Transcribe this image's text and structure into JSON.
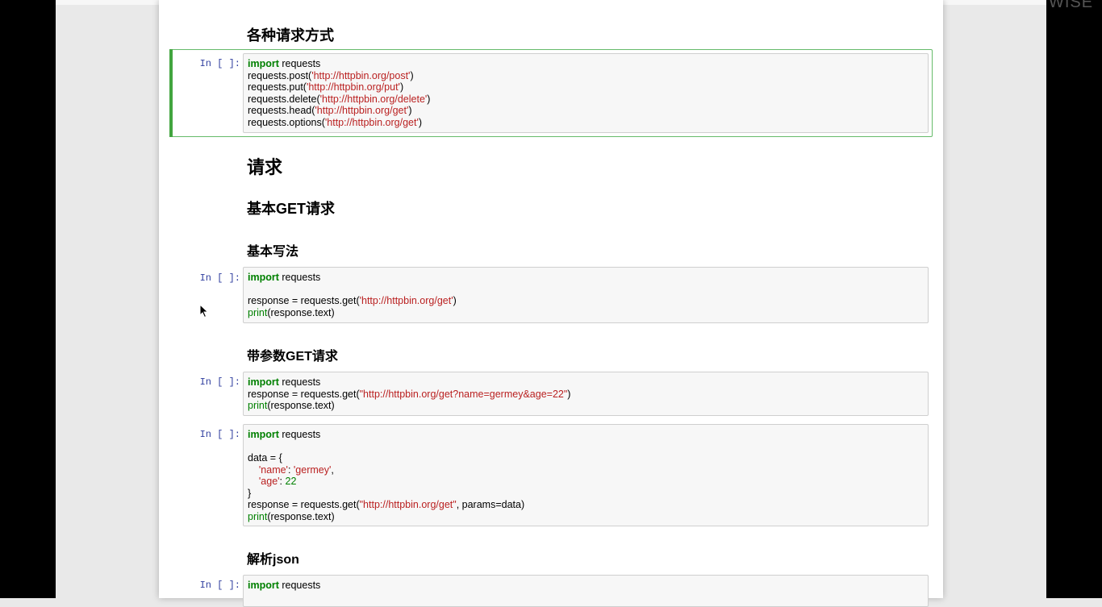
{
  "watermark": "WISE",
  "notebook": {
    "prompt": "In [ ]:",
    "headings": {
      "request_methods": "各种请求方式",
      "request": "请求",
      "basic_get": "基本GET请求",
      "basic_usage": "基本写法",
      "get_with_params": "带参数GET请求",
      "parse_json": "解析json"
    },
    "cells": [
      {
        "id": "methods",
        "lines": [
          [
            {
              "t": "import",
              "c": "kw"
            },
            {
              "t": " requests"
            }
          ],
          [
            {
              "t": "requests.post("
            },
            {
              "t": "'http://httpbin.org/post'",
              "c": "st"
            },
            {
              "t": ")"
            }
          ],
          [
            {
              "t": "requests.put("
            },
            {
              "t": "'http://httpbin.org/put'",
              "c": "st"
            },
            {
              "t": ")"
            }
          ],
          [
            {
              "t": "requests.delete("
            },
            {
              "t": "'http://httpbin.org/delete'",
              "c": "st"
            },
            {
              "t": ")"
            }
          ],
          [
            {
              "t": "requests.head("
            },
            {
              "t": "'http://httpbin.org/get'",
              "c": "st"
            },
            {
              "t": ")"
            }
          ],
          [
            {
              "t": "requests.options("
            },
            {
              "t": "'http://httpbin.org/get'",
              "c": "st"
            },
            {
              "t": ")"
            }
          ]
        ]
      },
      {
        "id": "basic",
        "lines": [
          [
            {
              "t": "import",
              "c": "kw"
            },
            {
              "t": " requests"
            }
          ],
          [],
          [
            {
              "t": "response = requests.get("
            },
            {
              "t": "'http://httpbin.org/get'",
              "c": "st"
            },
            {
              "t": ")"
            }
          ],
          [
            {
              "t": "print",
              "c": "bi"
            },
            {
              "t": "(response.text)"
            }
          ]
        ]
      },
      {
        "id": "params1",
        "lines": [
          [
            {
              "t": "import",
              "c": "kw"
            },
            {
              "t": " requests"
            }
          ],
          [
            {
              "t": "response = requests.get("
            },
            {
              "t": "\"http://httpbin.org/get?name=germey&age=22\"",
              "c": "st"
            },
            {
              "t": ")"
            }
          ],
          [
            {
              "t": "print",
              "c": "bi"
            },
            {
              "t": "(response.text)"
            }
          ]
        ]
      },
      {
        "id": "params2",
        "lines": [
          [
            {
              "t": "import",
              "c": "kw"
            },
            {
              "t": " requests"
            }
          ],
          [],
          [
            {
              "t": "data = {"
            }
          ],
          [
            {
              "t": "    "
            },
            {
              "t": "'name'",
              "c": "st"
            },
            {
              "t": ": "
            },
            {
              "t": "'germey'",
              "c": "st"
            },
            {
              "t": ","
            }
          ],
          [
            {
              "t": "    "
            },
            {
              "t": "'age'",
              "c": "st"
            },
            {
              "t": ": "
            },
            {
              "t": "22",
              "c": "nu"
            }
          ],
          [
            {
              "t": "}"
            }
          ],
          [
            {
              "t": "response = requests.get("
            },
            {
              "t": "\"http://httpbin.org/get\"",
              "c": "st"
            },
            {
              "t": ", params=data)"
            }
          ],
          [
            {
              "t": "print",
              "c": "bi"
            },
            {
              "t": "(response.text)"
            }
          ]
        ]
      },
      {
        "id": "json",
        "lines": [
          [
            {
              "t": "import",
              "c": "kw"
            },
            {
              "t": " requests"
            }
          ]
        ]
      }
    ]
  }
}
